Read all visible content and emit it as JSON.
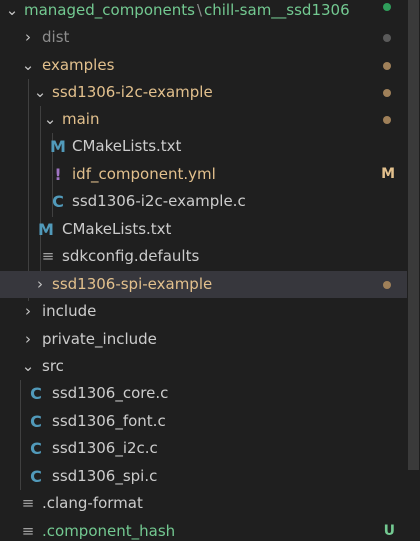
{
  "breadcrumb": {
    "parent": "managed_components",
    "separator": "\\",
    "current": "chill-sam__ssd1306"
  },
  "tree": {
    "dist": "dist",
    "examples": "examples",
    "ssd1306_i2c_example": "ssd1306-i2c-example",
    "main": "main",
    "cmakelists_main": "CMakeLists.txt",
    "idf_component": "idf_component.yml",
    "ssd1306_i2c_example_c": "ssd1306-i2c-example.c",
    "cmakelists_example": "CMakeLists.txt",
    "sdkconfig_defaults": "sdkconfig.defaults",
    "ssd1306_spi_example": "ssd1306-spi-example",
    "include": "include",
    "private_include": "private_include",
    "src": "src",
    "ssd1306_core": "ssd1306_core.c",
    "ssd1306_font": "ssd1306_font.c",
    "ssd1306_i2c": "ssd1306_i2c.c",
    "ssd1306_spi": "ssd1306_spi.c",
    "clang_format": ".clang-format",
    "component_hash": ".component_hash"
  },
  "badges": {
    "modified": "M",
    "untracked": "U"
  },
  "icons": {
    "cmake": "M",
    "c_source": "C",
    "yaml": "!",
    "plain_text": "≡",
    "chevron_down": "⌄",
    "chevron_right": "›"
  },
  "colors": {
    "background": "#1f1f1f",
    "selected_row": "#37373d",
    "modified": "#e2c08d",
    "untracked": "#73c991",
    "ignored": "#8c8c8c",
    "c_icon": "#519aba",
    "yaml_icon": "#a074c4",
    "git_dot_green": "#2f9e5b",
    "git_dot_gray": "#5a5a5a",
    "git_dot_modified": "#9f8059"
  }
}
